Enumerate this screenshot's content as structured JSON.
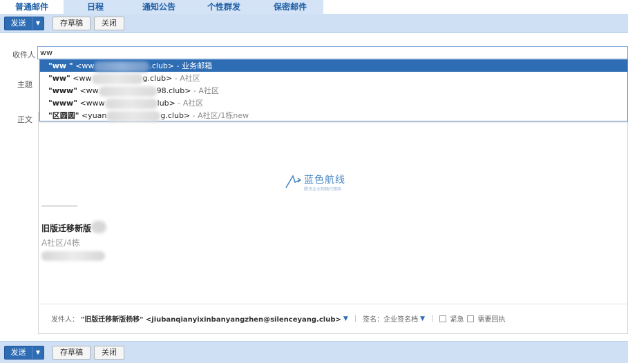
{
  "tabs": [
    {
      "label": "普通邮件",
      "active": true
    },
    {
      "label": "日程",
      "active": false
    },
    {
      "label": "通知公告",
      "active": false
    },
    {
      "label": "个性群发",
      "active": false
    },
    {
      "label": "保密邮件",
      "active": false
    }
  ],
  "toolbar": {
    "send_label": "发送",
    "send_arrow": "▼",
    "draft_label": "存草稿",
    "close_label": "关闭"
  },
  "form": {
    "to_label": "收件人",
    "to_value": "ww",
    "subject_label": "主题",
    "body_label": "正文"
  },
  "suggestions": [
    {
      "name": "\"ww \"",
      "addr_prefix": " <ww",
      "addr_suffix": ".club>",
      "group": " - 业务邮箱"
    },
    {
      "name": "\"ww\"",
      "addr_prefix": " <ww",
      "addr_suffix": "g.club>",
      "group": " - A社区"
    },
    {
      "name": "\"www\"",
      "addr_prefix": " <ww",
      "addr_suffix": "98.club>",
      "group": " - A社区"
    },
    {
      "name": "\"www\"",
      "addr_prefix": " <www",
      "addr_suffix": "lub>",
      "group": " - A社区"
    },
    {
      "name": "\"区圆圆\"",
      "addr_prefix": " <yuan",
      "addr_suffix": "g.club>",
      "group": " - A社区/1栋new"
    }
  ],
  "logo": {
    "title": "蓝色航线",
    "subtitle": "腾讯企业邮箱代理商"
  },
  "signature": {
    "name": "旧版迁移新版",
    "org": "A社区/4栋"
  },
  "footer": {
    "sender_label": "发件人：",
    "sender_value": "\"旧版迁移新版杨移\" <jiubanqianyixinbanyangzhen@silenceyang.club>",
    "tri": "▼",
    "sep": "|",
    "signature_label": "签名：企业签名档",
    "urgent_label": "紧急",
    "receipt_label": "需要回执"
  },
  "colors": {
    "accent": "#2e6db4",
    "toolbar_bg": "#cfe0f4",
    "tab_strip": "#d4e3f5"
  }
}
